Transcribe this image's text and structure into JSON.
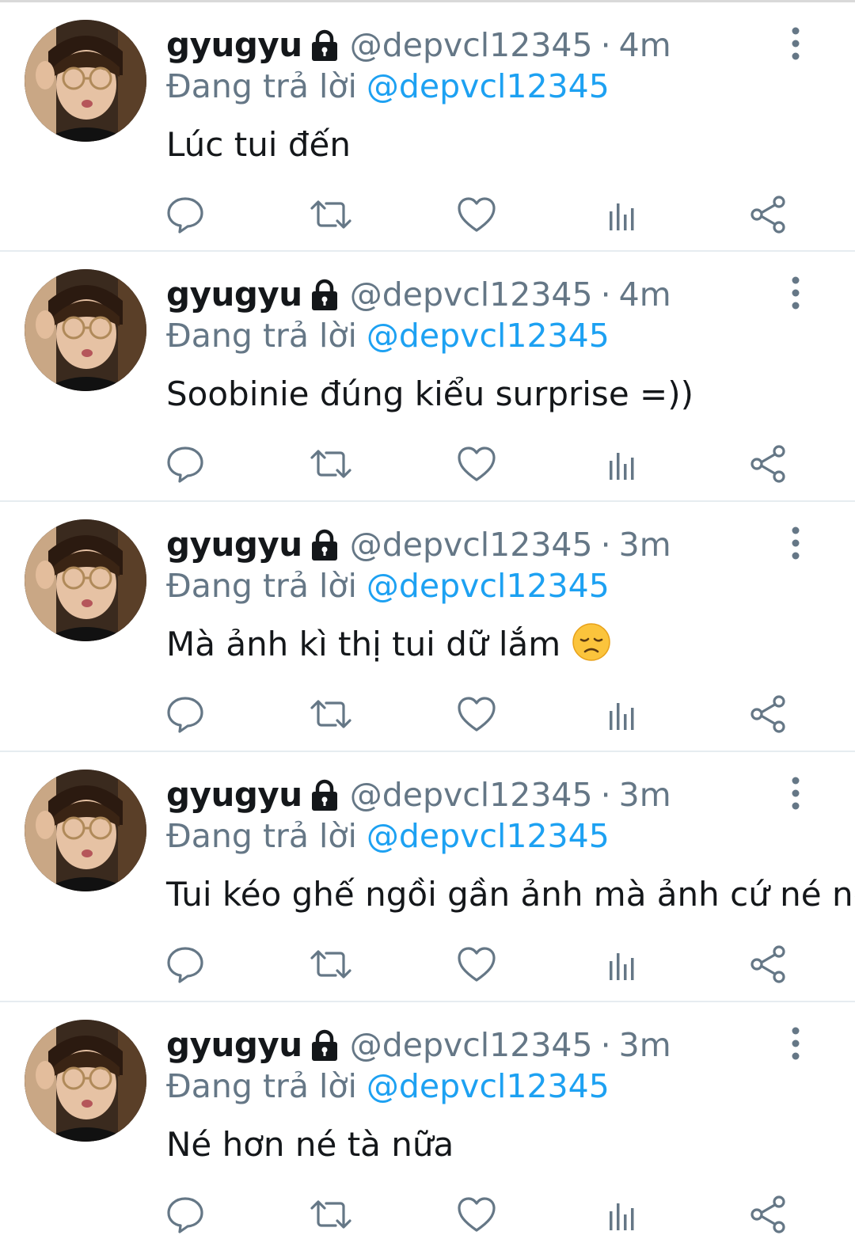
{
  "colors": {
    "text_primary": "#14171a",
    "text_secondary": "#657786",
    "link": "#1da1f2",
    "divider": "#e6ecf0"
  },
  "tweets": [
    {
      "name": "gyugyu",
      "handle": "@depvcl12345",
      "separator": "·",
      "time": "4m",
      "reply_prefix": "Đang trả lời",
      "reply_to": "@depvcl12345",
      "text": "Lúc tui đến",
      "emoji": ""
    },
    {
      "name": "gyugyu",
      "handle": "@depvcl12345",
      "separator": "·",
      "time": "4m",
      "reply_prefix": "Đang trả lời",
      "reply_to": "@depvcl12345",
      "text": "Soobinie đúng kiểu surprise =))",
      "emoji": ""
    },
    {
      "name": "gyugyu",
      "handle": "@depvcl12345",
      "separator": "·",
      "time": "3m",
      "reply_prefix": "Đang trả lời",
      "reply_to": "@depvcl12345",
      "text": "Mà ảnh kì thị tui dữ lắm",
      "emoji": "disappointed-face"
    },
    {
      "name": "gyugyu",
      "handle": "@depvcl12345",
      "separator": "·",
      "time": "3m",
      "reply_prefix": "Đang trả lời",
      "reply_to": "@depvcl12345",
      "text": "Tui kéo ghế ngồi gần ảnh mà ảnh cứ né né",
      "emoji": ""
    },
    {
      "name": "gyugyu",
      "handle": "@depvcl12345",
      "separator": "·",
      "time": "3m",
      "reply_prefix": "Đang trả lời",
      "reply_to": "@depvcl12345",
      "text": "Né hơn né tà nữa",
      "emoji": ""
    }
  ],
  "icons": {
    "lock": "lock-icon",
    "more": "more-vertical-icon",
    "reply": "reply-icon",
    "retweet": "retweet-icon",
    "like": "heart-icon",
    "stats": "analytics-icon",
    "share": "share-icon"
  }
}
